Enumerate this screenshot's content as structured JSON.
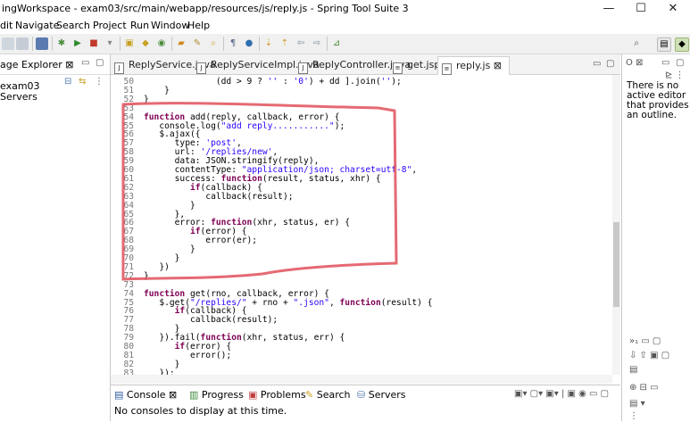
{
  "window": {
    "title": "ingWorkspace - exam03/src/main/webapp/resources/js/reply.js - Spring Tool Suite 3",
    "minimize": "—",
    "maximize": "☐",
    "close": "✕"
  },
  "menu": [
    "dit",
    "Navigate",
    "Search",
    "Project",
    "Run",
    "Window",
    "Help"
  ],
  "left_panel": {
    "title": "age Explorer ⊠",
    "items": [
      "exam03",
      "Servers"
    ]
  },
  "editor": {
    "tabs": [
      "ReplyService.java",
      "ReplyServiceImpl.java",
      "ReplyController.java",
      "get.jsp",
      "reply.js ⊠"
    ],
    "active_tab": "reply.js ⊠",
    "lines": [
      {
        "n": "50",
        "t": "              (dd > 9 ? '' : '0') + dd ].join('');"
      },
      {
        "n": "51",
        "t": "    }"
      },
      {
        "n": "52",
        "t": "}"
      },
      {
        "n": "53",
        "t": ""
      },
      {
        "n": "54",
        "t": "function add(reply, callback, error) {"
      },
      {
        "n": "55",
        "t": "   console.log(\"add reply...........\");"
      },
      {
        "n": "56",
        "t": "   $.ajax({"
      },
      {
        "n": "57",
        "t": "      type: 'post',"
      },
      {
        "n": "58",
        "t": "      url: '/replies/new',"
      },
      {
        "n": "59",
        "t": "      data: JSON.stringify(reply),"
      },
      {
        "n": "60",
        "t": "      contentType: \"application/json; charset=utf-8\","
      },
      {
        "n": "61",
        "t": "      success: function(result, status, xhr) {"
      },
      {
        "n": "62",
        "t": "         if(callback) {"
      },
      {
        "n": "63",
        "t": "            callback(result);"
      },
      {
        "n": "64",
        "t": "         }"
      },
      {
        "n": "65",
        "t": "      },"
      },
      {
        "n": "66",
        "t": "      error: function(xhr, status, er) {"
      },
      {
        "n": "67",
        "t": "         if(error) {"
      },
      {
        "n": "68",
        "t": "            error(er);"
      },
      {
        "n": "69",
        "t": "         }"
      },
      {
        "n": "70",
        "t": "      }"
      },
      {
        "n": "71",
        "t": "   })"
      },
      {
        "n": "72",
        "t": "}"
      },
      {
        "n": "73",
        "t": ""
      },
      {
        "n": "74",
        "t": "function get(rno, callback, error) {"
      },
      {
        "n": "75",
        "t": "   $.get(\"/replies/\" + rno + \".json\", function(result) {"
      },
      {
        "n": "76",
        "t": "      if(callback) {"
      },
      {
        "n": "77",
        "t": "         callback(result);"
      },
      {
        "n": "78",
        "t": "      }"
      },
      {
        "n": "79",
        "t": "   }).fail(function(xhr, status, err) {"
      },
      {
        "n": "80",
        "t": "      if(error) {"
      },
      {
        "n": "81",
        "t": "         error();"
      },
      {
        "n": "82",
        "t": "      }"
      },
      {
        "n": "83",
        "t": "   });"
      }
    ]
  },
  "console": {
    "tabs": [
      "Console ⊠",
      "Progress",
      "Problems",
      "Search",
      "Servers"
    ],
    "message": "No consoles to display at this time."
  },
  "outline": {
    "message": "There is no active editor that provides an outline."
  },
  "colors": {
    "annotation": "#e0505a",
    "keyword": "#7f0055",
    "string": "#2a00ff"
  }
}
